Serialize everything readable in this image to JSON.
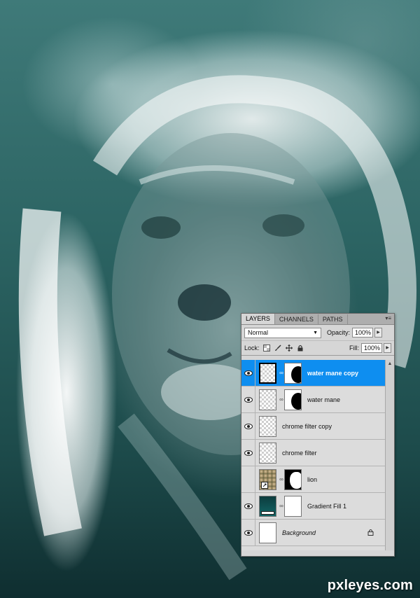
{
  "panel": {
    "tabs": [
      {
        "label": "LAYERS",
        "active": true
      },
      {
        "label": "CHANNELS",
        "active": false
      },
      {
        "label": "PATHS",
        "active": false
      }
    ],
    "menu_glyph": "▾≡",
    "blend_mode": "Normal",
    "opacity_label": "Opacity:",
    "opacity_value": "100%",
    "lock_label": "Lock:",
    "fill_label": "Fill:",
    "fill_value": "100%",
    "layers": [
      {
        "name": "water mane copy",
        "visible": true,
        "selected": true,
        "thumb": "transparent",
        "mask": "black-right",
        "italic": false,
        "locked": false
      },
      {
        "name": "water mane",
        "visible": true,
        "selected": false,
        "thumb": "transparent",
        "mask": "black-right",
        "italic": false,
        "locked": false
      },
      {
        "name": "chrome filter copy",
        "visible": true,
        "selected": false,
        "thumb": "transparent",
        "mask": null,
        "italic": false,
        "locked": false
      },
      {
        "name": "chrome filter",
        "visible": true,
        "selected": false,
        "thumb": "transparent",
        "mask": null,
        "italic": false,
        "locked": false
      },
      {
        "name": "lion",
        "visible": false,
        "selected": false,
        "thumb": "photo",
        "mask": "black-left",
        "italic": false,
        "locked": false
      },
      {
        "name": "Gradient Fill 1",
        "visible": true,
        "selected": false,
        "thumb": "gradient",
        "mask": "white",
        "italic": false,
        "locked": false
      },
      {
        "name": "Background",
        "visible": true,
        "selected": false,
        "thumb": "white",
        "mask": null,
        "italic": true,
        "locked": true
      }
    ]
  },
  "watermark": "pxleyes.com",
  "colors": {
    "selection": "#0e8ef0",
    "background_teal": "#1b4a4a",
    "panel_gray": "#d6d6d6"
  }
}
